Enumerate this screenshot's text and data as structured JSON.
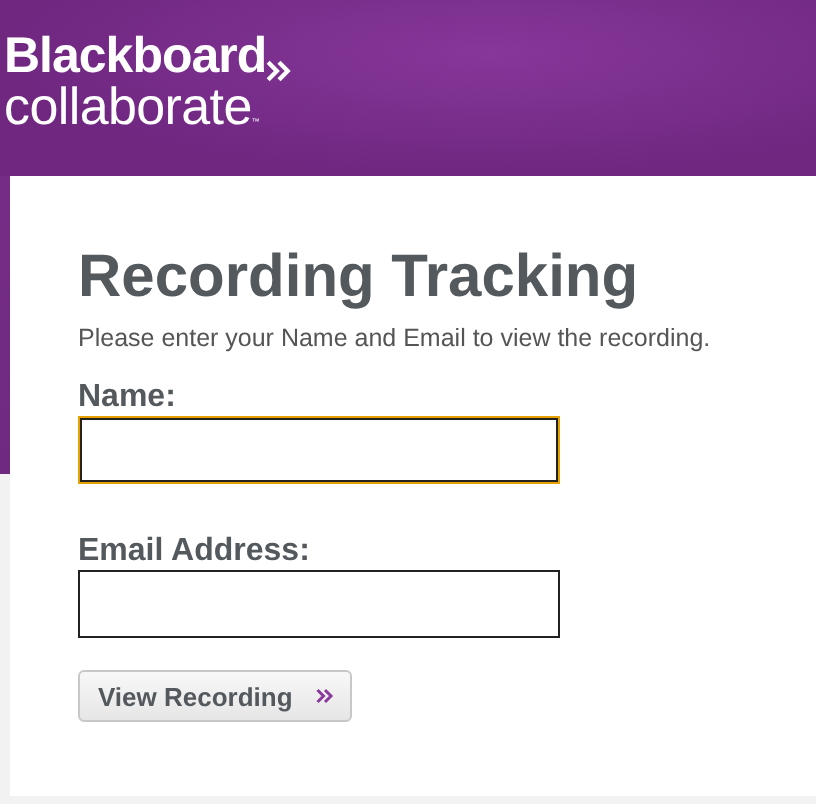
{
  "logo": {
    "line_1": "Blackboard",
    "line_2": "collaborate",
    "trademark": "™"
  },
  "form": {
    "title": "Recording Tracking",
    "instructions": "Please enter your Name and Email to view the recording.",
    "fields": [
      {
        "label": "Name:",
        "focused": true
      },
      {
        "label": "Email Address:",
        "focused": false
      }
    ],
    "button": {
      "label": "View Recording"
    }
  }
}
